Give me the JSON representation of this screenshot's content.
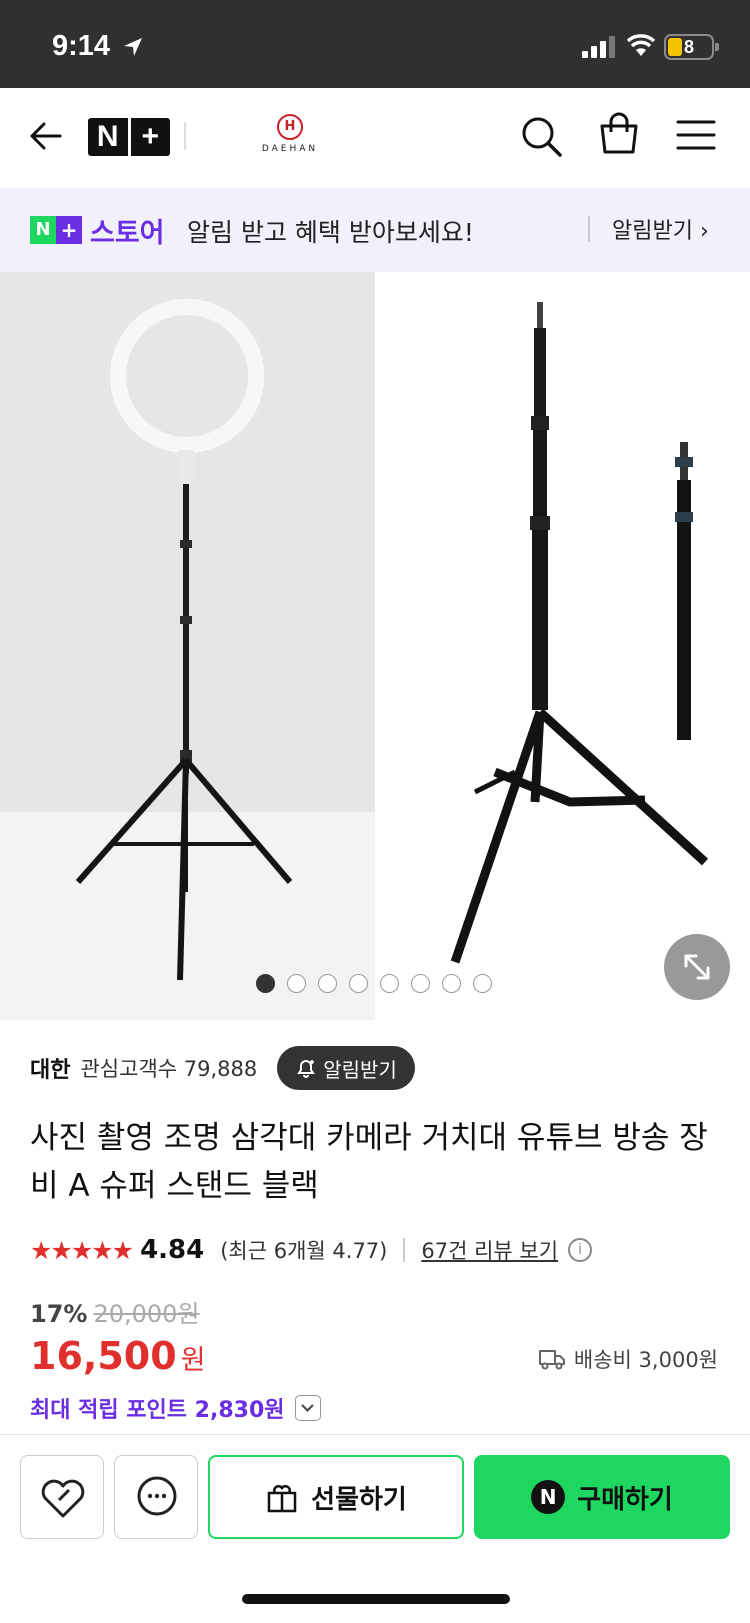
{
  "status_bar": {
    "time": "9:14",
    "battery": "8"
  },
  "header": {
    "store_badge": [
      "N",
      "+"
    ],
    "brand_mark": "H",
    "brand_name": "DAEHAN"
  },
  "banner": {
    "logo_n": "N",
    "logo_plus": "+",
    "store_label": "스토어",
    "message": "알림 받고 혜택 받아보세요!",
    "cta": "알림받기 ›"
  },
  "gallery": {
    "image_count": 8,
    "active_index": 0
  },
  "product": {
    "seller": "대한",
    "followers_label": "관심고객수 79,888",
    "alarm_button": "알림받기",
    "title": "사진 촬영 조명 삼각대 카메라 거치대 유튜브 방송 장비 A 슈퍼 스탠드 블랙",
    "stars": "★★★★★",
    "rating": "4.84",
    "recent_rating": "(최근 6개월 4.77)",
    "reviews_link": "67건 리뷰 보기",
    "discount_pct": "17%",
    "original_price": "20,000원",
    "price": "16,500",
    "currency": "원",
    "shipping": "배송비 3,000원",
    "points": "최대 적립 포인트 2,830원"
  },
  "actions": {
    "gift_label": "선물하기",
    "buy_badge": "N",
    "buy_label": "구매하기"
  },
  "colors": {
    "naver_green": "#1ed760",
    "naver_purple": "#6b2ee3",
    "price_red": "#e0302e"
  },
  "icons": [
    "back-arrow-icon",
    "search-icon",
    "shopping-bag-icon",
    "menu-icon",
    "bell-plus-icon",
    "info-icon",
    "truck-icon",
    "chevron-down-icon",
    "heart-icon",
    "chat-icon",
    "gift-icon",
    "expand-icon"
  ]
}
